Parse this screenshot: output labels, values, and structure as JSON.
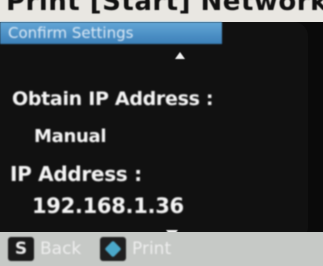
{
  "caption": {
    "text": "Print [Start] Network"
  },
  "screen": {
    "title": "Confirm Settings",
    "obtain_ip_label": "Obtain IP Address :",
    "obtain_ip_value": "Manual",
    "ip_address_label": "IP Address :",
    "ip_address_value": "192.168.1.36",
    "scroll_up_icon": "up-triangle",
    "scroll_down_icon": "down-triangle"
  },
  "footer": {
    "back_key": "S",
    "back_label": "Back",
    "print_icon": "diamond",
    "print_label": "Print"
  },
  "colors": {
    "title_bar": "#4a90c8",
    "screen_bg": "#0b0b0b",
    "footer_bg": "#c6c9c6",
    "print_diamond": "#4aa8c9"
  }
}
